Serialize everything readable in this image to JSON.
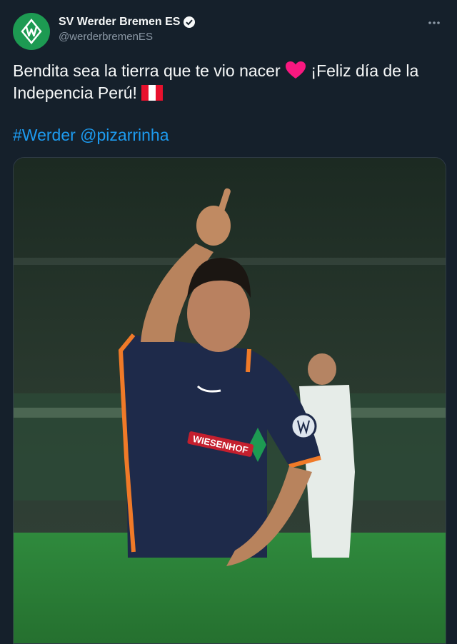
{
  "account": {
    "name": "SV Werder Bremen ES",
    "handle": "@werderbremenES",
    "verified": true
  },
  "tweet": {
    "line1_a": "Bendita sea la tierra que te vio nacer ",
    "line1_b": " ¡Feliz día de la",
    "line2_a": "Indepencia Perú! ",
    "hashtag": "#Werder",
    "mention": "@pizarrinha"
  },
  "image": {
    "jersey_text": "WIESENHOF"
  },
  "icons": {
    "more": "more-horizontal-icon",
    "verified": "verified-badge-icon",
    "heart": "red-heart-emoji",
    "flag": "peru-flag-emoji"
  },
  "colors": {
    "background": "#15202b",
    "link": "#1d9bf0",
    "werder_green": "#1d9a52",
    "heart": "#f91880"
  }
}
